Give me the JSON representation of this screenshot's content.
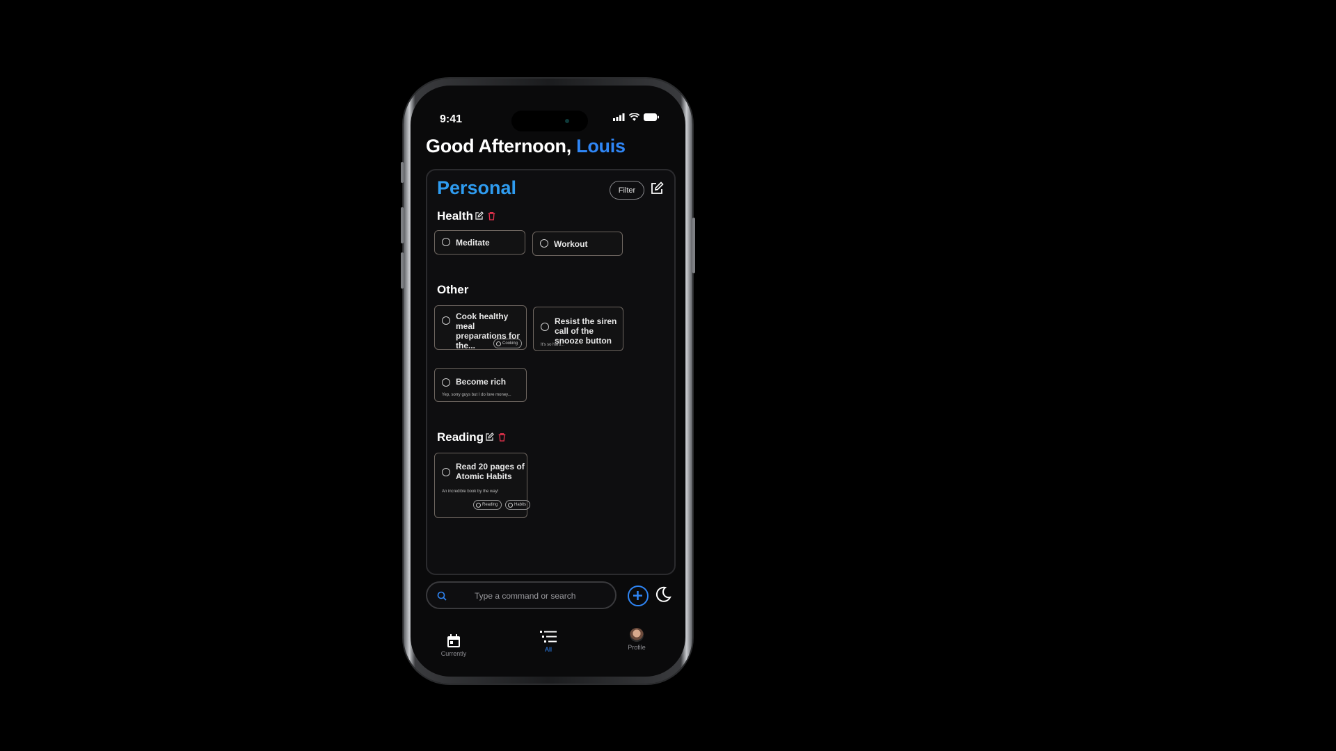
{
  "status_bar": {
    "time": "9:41"
  },
  "greeting": {
    "prefix": "Good Afternoon, ",
    "name": "Louis"
  },
  "panel": {
    "title": "Personal",
    "filter_label": "Filter",
    "sections": [
      {
        "label": "Health",
        "cards": [
          {
            "title": "Meditate"
          },
          {
            "title": "Workout"
          }
        ]
      },
      {
        "label": "Other",
        "cards": [
          {
            "title": "Cook healthy meal preparations for the...",
            "tags": [
              "Cooking"
            ]
          },
          {
            "title": "Resist the siren call of the snooze button",
            "description": "It's so hard..."
          },
          {
            "title": "Become rich",
            "description": "Yep, sorry guys but I do love money..."
          }
        ]
      },
      {
        "label": "Reading",
        "cards": [
          {
            "title": "Read 20 pages of Atomic Habits",
            "description": "An incredible book by the way!",
            "tags": [
              "Reading",
              "Habits"
            ]
          }
        ]
      }
    ]
  },
  "search": {
    "placeholder": "Type a command or search"
  },
  "tabbar": {
    "items": [
      {
        "label": "Currently",
        "icon": "calendar-icon"
      },
      {
        "label": "All",
        "icon": "list-icon",
        "active": true
      },
      {
        "label": "Profile",
        "icon": "avatar"
      }
    ]
  },
  "colors": {
    "accent": "#2f86f6",
    "title_blue": "#2f9cf0",
    "delete_red": "#e0314b",
    "background": "#0a0a0b"
  }
}
